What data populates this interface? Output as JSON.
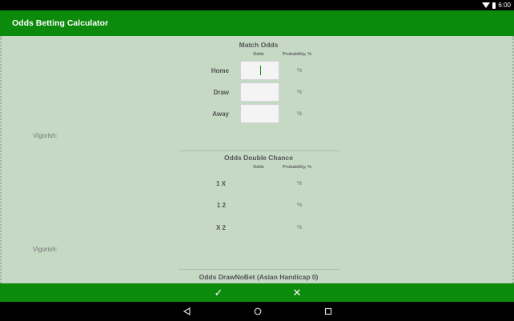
{
  "status_bar": {
    "time": "6:00",
    "icons": [
      "wifi-icon",
      "battery-icon"
    ]
  },
  "app_bar": {
    "title": "Odds Betting Calculator"
  },
  "match_odds": {
    "title": "Match Odds",
    "col_odds": "Odds",
    "col_probability": "Probability, %",
    "rows": [
      {
        "label": "Home",
        "value": "",
        "pct": "%"
      },
      {
        "label": "Draw",
        "value": "",
        "pct": "%"
      },
      {
        "label": "Away",
        "value": "",
        "pct": "%"
      }
    ],
    "vigorish_label": "Vigorish:"
  },
  "double_chance": {
    "title": "Odds Double Chance",
    "col_odds": "Odds",
    "col_probability": "Probability, %",
    "rows": [
      {
        "label": "1 X",
        "pct": "%"
      },
      {
        "label": "1 2",
        "pct": "%"
      },
      {
        "label": "X 2",
        "pct": "%"
      }
    ],
    "vigorish_label": "Vigorish:"
  },
  "draw_no_bet": {
    "title": "Odds DrawNoBet (Asian Handicap 0)"
  },
  "bottom_bar": {
    "confirm_icon": "check-icon",
    "cancel_icon": "close-icon",
    "confirm_glyph": "✓",
    "cancel_glyph": "✕"
  },
  "nav_bar": {
    "icons": [
      "back-icon",
      "home-icon",
      "recents-icon"
    ]
  },
  "colors": {
    "primary": "#0b8a0b",
    "background": "#c5d9c5",
    "accent_cursor": "#0b8a0b"
  }
}
